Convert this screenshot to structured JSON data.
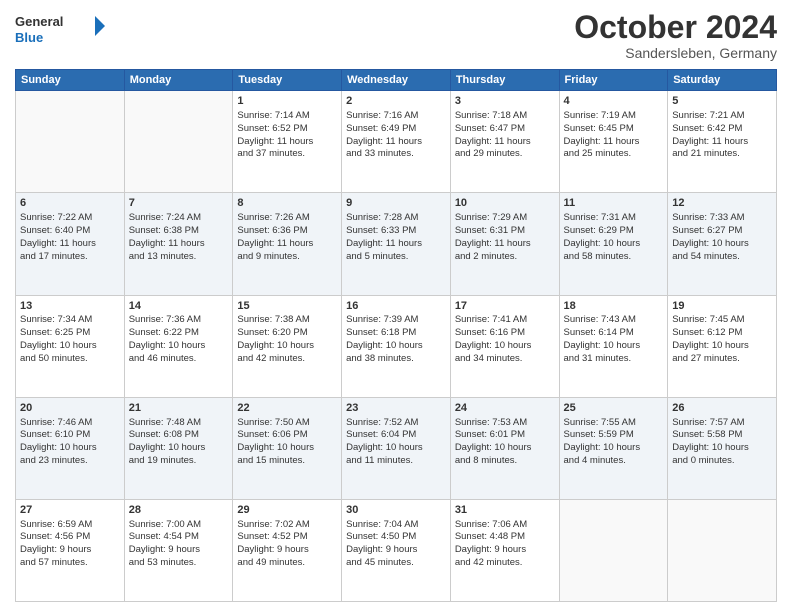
{
  "logo": {
    "general": "General",
    "blue": "Blue"
  },
  "title": "October 2024",
  "subtitle": "Sandersleben, Germany",
  "days_header": [
    "Sunday",
    "Monday",
    "Tuesday",
    "Wednesday",
    "Thursday",
    "Friday",
    "Saturday"
  ],
  "weeks": [
    [
      {
        "day": "",
        "detail": ""
      },
      {
        "day": "",
        "detail": ""
      },
      {
        "day": "1",
        "detail": "Sunrise: 7:14 AM\nSunset: 6:52 PM\nDaylight: 11 hours\nand 37 minutes."
      },
      {
        "day": "2",
        "detail": "Sunrise: 7:16 AM\nSunset: 6:49 PM\nDaylight: 11 hours\nand 33 minutes."
      },
      {
        "day": "3",
        "detail": "Sunrise: 7:18 AM\nSunset: 6:47 PM\nDaylight: 11 hours\nand 29 minutes."
      },
      {
        "day": "4",
        "detail": "Sunrise: 7:19 AM\nSunset: 6:45 PM\nDaylight: 11 hours\nand 25 minutes."
      },
      {
        "day": "5",
        "detail": "Sunrise: 7:21 AM\nSunset: 6:42 PM\nDaylight: 11 hours\nand 21 minutes."
      }
    ],
    [
      {
        "day": "6",
        "detail": "Sunrise: 7:22 AM\nSunset: 6:40 PM\nDaylight: 11 hours\nand 17 minutes."
      },
      {
        "day": "7",
        "detail": "Sunrise: 7:24 AM\nSunset: 6:38 PM\nDaylight: 11 hours\nand 13 minutes."
      },
      {
        "day": "8",
        "detail": "Sunrise: 7:26 AM\nSunset: 6:36 PM\nDaylight: 11 hours\nand 9 minutes."
      },
      {
        "day": "9",
        "detail": "Sunrise: 7:28 AM\nSunset: 6:33 PM\nDaylight: 11 hours\nand 5 minutes."
      },
      {
        "day": "10",
        "detail": "Sunrise: 7:29 AM\nSunset: 6:31 PM\nDaylight: 11 hours\nand 2 minutes."
      },
      {
        "day": "11",
        "detail": "Sunrise: 7:31 AM\nSunset: 6:29 PM\nDaylight: 10 hours\nand 58 minutes."
      },
      {
        "day": "12",
        "detail": "Sunrise: 7:33 AM\nSunset: 6:27 PM\nDaylight: 10 hours\nand 54 minutes."
      }
    ],
    [
      {
        "day": "13",
        "detail": "Sunrise: 7:34 AM\nSunset: 6:25 PM\nDaylight: 10 hours\nand 50 minutes."
      },
      {
        "day": "14",
        "detail": "Sunrise: 7:36 AM\nSunset: 6:22 PM\nDaylight: 10 hours\nand 46 minutes."
      },
      {
        "day": "15",
        "detail": "Sunrise: 7:38 AM\nSunset: 6:20 PM\nDaylight: 10 hours\nand 42 minutes."
      },
      {
        "day": "16",
        "detail": "Sunrise: 7:39 AM\nSunset: 6:18 PM\nDaylight: 10 hours\nand 38 minutes."
      },
      {
        "day": "17",
        "detail": "Sunrise: 7:41 AM\nSunset: 6:16 PM\nDaylight: 10 hours\nand 34 minutes."
      },
      {
        "day": "18",
        "detail": "Sunrise: 7:43 AM\nSunset: 6:14 PM\nDaylight: 10 hours\nand 31 minutes."
      },
      {
        "day": "19",
        "detail": "Sunrise: 7:45 AM\nSunset: 6:12 PM\nDaylight: 10 hours\nand 27 minutes."
      }
    ],
    [
      {
        "day": "20",
        "detail": "Sunrise: 7:46 AM\nSunset: 6:10 PM\nDaylight: 10 hours\nand 23 minutes."
      },
      {
        "day": "21",
        "detail": "Sunrise: 7:48 AM\nSunset: 6:08 PM\nDaylight: 10 hours\nand 19 minutes."
      },
      {
        "day": "22",
        "detail": "Sunrise: 7:50 AM\nSunset: 6:06 PM\nDaylight: 10 hours\nand 15 minutes."
      },
      {
        "day": "23",
        "detail": "Sunrise: 7:52 AM\nSunset: 6:04 PM\nDaylight: 10 hours\nand 11 minutes."
      },
      {
        "day": "24",
        "detail": "Sunrise: 7:53 AM\nSunset: 6:01 PM\nDaylight: 10 hours\nand 8 minutes."
      },
      {
        "day": "25",
        "detail": "Sunrise: 7:55 AM\nSunset: 5:59 PM\nDaylight: 10 hours\nand 4 minutes."
      },
      {
        "day": "26",
        "detail": "Sunrise: 7:57 AM\nSunset: 5:58 PM\nDaylight: 10 hours\nand 0 minutes."
      }
    ],
    [
      {
        "day": "27",
        "detail": "Sunrise: 6:59 AM\nSunset: 4:56 PM\nDaylight: 9 hours\nand 57 minutes."
      },
      {
        "day": "28",
        "detail": "Sunrise: 7:00 AM\nSunset: 4:54 PM\nDaylight: 9 hours\nand 53 minutes."
      },
      {
        "day": "29",
        "detail": "Sunrise: 7:02 AM\nSunset: 4:52 PM\nDaylight: 9 hours\nand 49 minutes."
      },
      {
        "day": "30",
        "detail": "Sunrise: 7:04 AM\nSunset: 4:50 PM\nDaylight: 9 hours\nand 45 minutes."
      },
      {
        "day": "31",
        "detail": "Sunrise: 7:06 AM\nSunset: 4:48 PM\nDaylight: 9 hours\nand 42 minutes."
      },
      {
        "day": "",
        "detail": ""
      },
      {
        "day": "",
        "detail": ""
      }
    ]
  ]
}
